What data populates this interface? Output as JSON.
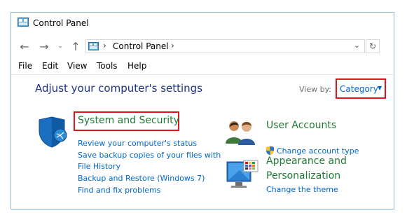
{
  "window": {
    "title": "Control Panel"
  },
  "nav": {
    "back_icon": "arrow-left-icon",
    "forward_icon": "arrow-right-icon",
    "recent_icon": "chevron-down-icon",
    "up_icon": "arrow-up-icon",
    "address_text": "Control Panel",
    "refresh_icon": "refresh-icon"
  },
  "menu": [
    "File",
    "Edit",
    "View",
    "Tools",
    "Help"
  ],
  "heading": "Adjust your computer's settings",
  "view_by": {
    "label": "View by:",
    "value": "Category"
  },
  "categories": {
    "system_security": {
      "title": "System and Security",
      "links": [
        "Review your computer's status",
        "Save backup copies of your files with",
        "File History",
        "Backup and Restore (Windows 7)",
        "Find and fix problems"
      ]
    },
    "user_accounts": {
      "title": "User Accounts",
      "links": [
        "Change account type"
      ]
    },
    "appearance": {
      "title_line1": "Appearance and",
      "title_line2": "Personalization",
      "links": [
        "Change the theme"
      ]
    }
  },
  "colors": {
    "heading": "#1e3287",
    "link": "#0066cc",
    "category_title": "#1f7a35",
    "highlight_box": "#e1131e"
  }
}
